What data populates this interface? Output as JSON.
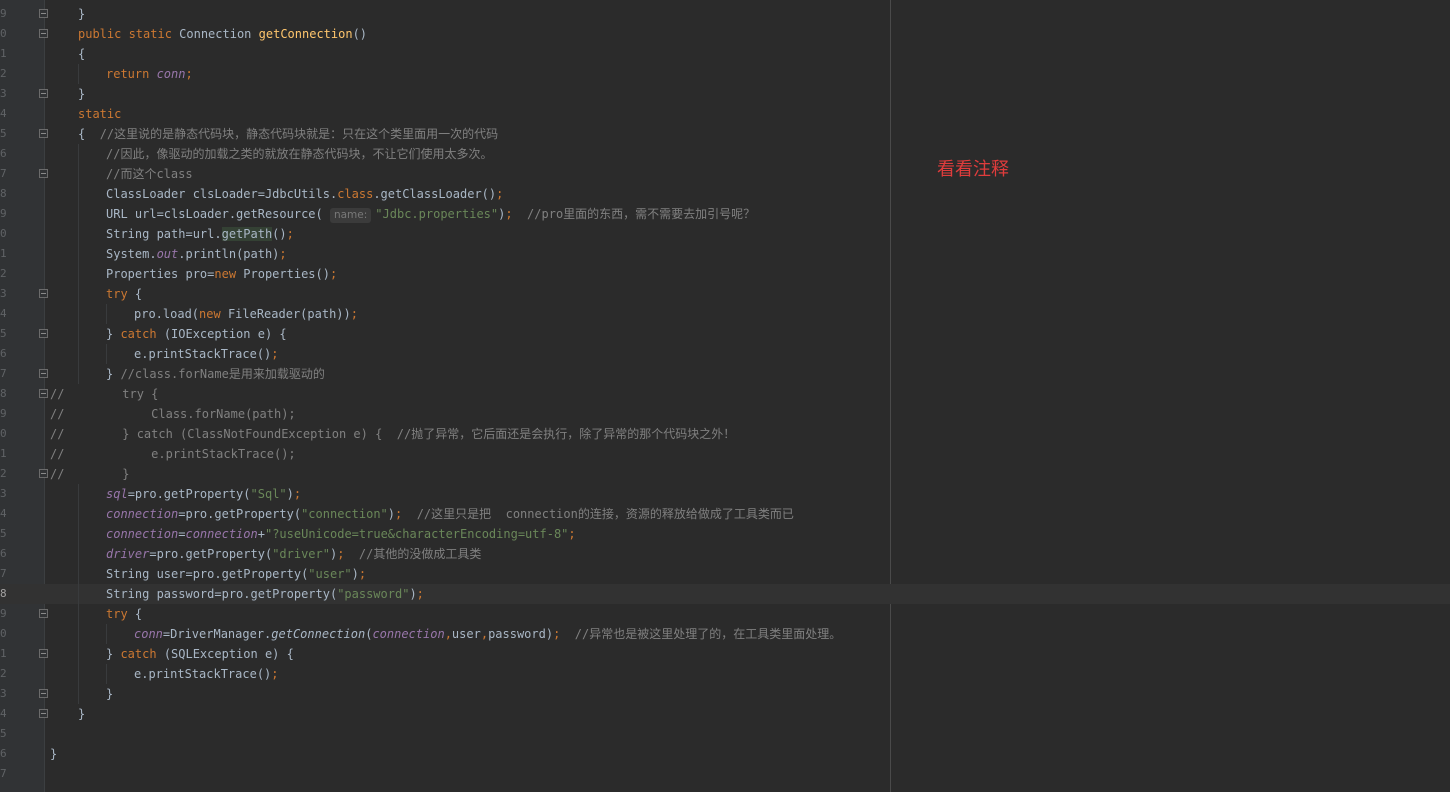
{
  "editor": {
    "lines": [
      {
        "n": "9",
        "fold": true,
        "indent": 1,
        "segs": [
          [
            "",
            "}"
          ]
        ]
      },
      {
        "n": "0",
        "fold": true,
        "indent": 1,
        "segs": [
          [
            "kw",
            "public static "
          ],
          [
            "",
            "Connection "
          ],
          [
            "fn",
            "getConnection"
          ],
          [
            "",
            "()"
          ]
        ]
      },
      {
        "n": "1",
        "fold": false,
        "indent": 1,
        "segs": [
          [
            "",
            "{"
          ]
        ]
      },
      {
        "n": "2",
        "fold": false,
        "indent": 2,
        "segs": [
          [
            "kw",
            "return "
          ],
          [
            "field",
            "conn"
          ],
          [
            "kw",
            ";"
          ]
        ]
      },
      {
        "n": "3",
        "fold": true,
        "indent": 1,
        "segs": [
          [
            "",
            "}"
          ]
        ]
      },
      {
        "n": "4",
        "fold": false,
        "indent": 1,
        "segs": [
          [
            "kw",
            "static"
          ]
        ]
      },
      {
        "n": "5",
        "fold": true,
        "indent": 1,
        "segs": [
          [
            "",
            "{  "
          ],
          [
            "cmt",
            "//这里说的是静态代码块，静态代码块就是：只在这个类里面用一次的代码"
          ]
        ]
      },
      {
        "n": "6",
        "fold": false,
        "indent": 2,
        "segs": [
          [
            "cmt",
            "//因此，像驱动的加载之类的就放在静态代码块，不让它们使用太多次。"
          ]
        ]
      },
      {
        "n": "7",
        "fold": true,
        "indent": 2,
        "segs": [
          [
            "cmt",
            "//而这个class"
          ]
        ]
      },
      {
        "n": "8",
        "fold": false,
        "indent": 2,
        "segs": [
          [
            "",
            "ClassLoader clsLoader=JdbcUtils."
          ],
          [
            "kw",
            "class"
          ],
          [
            "",
            ".getClassLoader()"
          ],
          [
            "kw",
            ";"
          ]
        ]
      },
      {
        "n": "9",
        "fold": false,
        "indent": 2,
        "segs": [
          [
            "",
            "URL url=clsLoader.getResource( "
          ],
          [
            "hint",
            "name:"
          ],
          [
            "str",
            "\"Jdbc.properties\""
          ],
          [
            "",
            ")"
          ],
          [
            "kw",
            ";"
          ],
          [
            "",
            "  "
          ],
          [
            "cmt",
            "//pro里面的东西，需不需要去加引号呢？"
          ]
        ]
      },
      {
        "n": "0",
        "fold": false,
        "indent": 2,
        "segs": [
          [
            "",
            "String path=url."
          ],
          [
            "hl",
            "getPath"
          ],
          [
            "",
            "()"
          ],
          [
            "kw",
            ";"
          ]
        ]
      },
      {
        "n": "1",
        "fold": false,
        "indent": 2,
        "segs": [
          [
            "",
            "System."
          ],
          [
            "static",
            "out"
          ],
          [
            "",
            ".println(path)"
          ],
          [
            "kw",
            ";"
          ]
        ]
      },
      {
        "n": "2",
        "fold": false,
        "indent": 2,
        "segs": [
          [
            "",
            "Properties pro="
          ],
          [
            "kw",
            "new "
          ],
          [
            "",
            "Properties()"
          ],
          [
            "kw",
            ";"
          ]
        ]
      },
      {
        "n": "3",
        "fold": true,
        "indent": 2,
        "segs": [
          [
            "kw",
            "try "
          ],
          [
            "",
            "{"
          ]
        ]
      },
      {
        "n": "4",
        "fold": false,
        "indent": 3,
        "segs": [
          [
            "",
            "pro.load("
          ],
          [
            "kw",
            "new "
          ],
          [
            "",
            "FileReader(path))"
          ],
          [
            "kw",
            ";"
          ]
        ]
      },
      {
        "n": "5",
        "fold": true,
        "indent": 2,
        "segs": [
          [
            "",
            "} "
          ],
          [
            "kw",
            "catch "
          ],
          [
            "",
            "(IOException e) {"
          ]
        ]
      },
      {
        "n": "6",
        "fold": false,
        "indent": 3,
        "segs": [
          [
            "",
            "e.printStackTrace()"
          ],
          [
            "kw",
            ";"
          ]
        ]
      },
      {
        "n": "7",
        "fold": true,
        "indent": 2,
        "segs": [
          [
            "",
            "} "
          ],
          [
            "cmt",
            "//class.forName是用来加载驱动的"
          ]
        ]
      },
      {
        "n": "8",
        "fold": true,
        "indent": 0,
        "segs": [
          [
            "cmt",
            "//        try {"
          ]
        ]
      },
      {
        "n": "9",
        "fold": false,
        "indent": 0,
        "segs": [
          [
            "cmt",
            "//            Class.forName(path);"
          ]
        ]
      },
      {
        "n": "0",
        "fold": false,
        "indent": 0,
        "segs": [
          [
            "cmt",
            "//        } catch (ClassNotFoundException e) {  //抛了异常，它后面还是会执行，除了异常的那个代码块之外！"
          ]
        ]
      },
      {
        "n": "1",
        "fold": false,
        "indent": 0,
        "segs": [
          [
            "cmt",
            "//            e.printStackTrace();"
          ]
        ]
      },
      {
        "n": "2",
        "fold": true,
        "indent": 0,
        "segs": [
          [
            "cmt",
            "//        }"
          ]
        ]
      },
      {
        "n": "3",
        "fold": false,
        "indent": 2,
        "segs": [
          [
            "field",
            "sql"
          ],
          [
            "",
            "=pro.getProperty("
          ],
          [
            "str",
            "\"Sql\""
          ],
          [
            "",
            ")"
          ],
          [
            "kw",
            ";"
          ]
        ]
      },
      {
        "n": "4",
        "fold": false,
        "indent": 2,
        "segs": [
          [
            "field",
            "connection"
          ],
          [
            "",
            "=pro.getProperty("
          ],
          [
            "str",
            "\"connection\""
          ],
          [
            "",
            ")"
          ],
          [
            "kw",
            ";"
          ],
          [
            "",
            "  "
          ],
          [
            "cmt",
            "//这里只是把  connection的连接，资源的释放给做成了工具类而已"
          ]
        ]
      },
      {
        "n": "5",
        "fold": false,
        "indent": 2,
        "segs": [
          [
            "field",
            "connection"
          ],
          [
            "",
            "="
          ],
          [
            "field",
            "connection"
          ],
          [
            "",
            "+"
          ],
          [
            "str",
            "\"?useUnicode=true&characterEncoding=utf-8\""
          ],
          [
            "kw",
            ";"
          ]
        ]
      },
      {
        "n": "6",
        "fold": false,
        "indent": 2,
        "segs": [
          [
            "field",
            "driver"
          ],
          [
            "",
            "=pro.getProperty("
          ],
          [
            "str",
            "\"driver\""
          ],
          [
            "",
            ")"
          ],
          [
            "kw",
            ";"
          ],
          [
            "",
            "  "
          ],
          [
            "cmt",
            "//其他的没做成工具类"
          ]
        ]
      },
      {
        "n": "7",
        "fold": false,
        "indent": 2,
        "segs": [
          [
            "",
            "String user=pro.getProperty("
          ],
          [
            "str",
            "\"user\""
          ],
          [
            "",
            ")"
          ],
          [
            "kw",
            ";"
          ]
        ]
      },
      {
        "n": "8",
        "fold": false,
        "indent": 2,
        "current": true,
        "segs": [
          [
            "",
            "String password=pro.getProperty("
          ],
          [
            "str",
            "\"password\""
          ],
          [
            "",
            ")"
          ],
          [
            "kw",
            ";"
          ]
        ]
      },
      {
        "n": "9",
        "fold": true,
        "indent": 2,
        "segs": [
          [
            "kw",
            "try "
          ],
          [
            "",
            "{"
          ]
        ]
      },
      {
        "n": "0",
        "fold": false,
        "indent": 3,
        "segs": [
          [
            "field",
            "conn"
          ],
          [
            "",
            "=DriverManager."
          ],
          [
            "it",
            "getConnection"
          ],
          [
            "",
            "("
          ],
          [
            "field",
            "connection"
          ],
          [
            "kw",
            ","
          ],
          [
            "",
            "user"
          ],
          [
            "kw",
            ","
          ],
          [
            "",
            "password)"
          ],
          [
            "kw",
            ";"
          ],
          [
            "",
            "  "
          ],
          [
            "cmt",
            "//异常也是被这里处理了的，在工具类里面处理。"
          ]
        ]
      },
      {
        "n": "1",
        "fold": true,
        "indent": 2,
        "segs": [
          [
            "",
            "} "
          ],
          [
            "kw",
            "catch "
          ],
          [
            "",
            "(SQLException e) {"
          ]
        ]
      },
      {
        "n": "2",
        "fold": false,
        "indent": 3,
        "segs": [
          [
            "",
            "e.printStackTrace()"
          ],
          [
            "kw",
            ";"
          ]
        ]
      },
      {
        "n": "3",
        "fold": true,
        "indent": 2,
        "segs": [
          [
            "",
            "}"
          ]
        ]
      },
      {
        "n": "4",
        "fold": true,
        "indent": 1,
        "segs": [
          [
            "",
            "}"
          ]
        ]
      },
      {
        "n": "5",
        "fold": false,
        "indent": 0,
        "segs": []
      },
      {
        "n": "6",
        "fold": false,
        "indent": 0,
        "segs": [
          [
            "",
            "}"
          ]
        ]
      },
      {
        "n": "7",
        "fold": false,
        "indent": 0,
        "segs": []
      }
    ]
  },
  "annotation": {
    "text": "看看注释",
    "color": "#e03c3c"
  },
  "colors": {
    "keyword": "#cc7832",
    "method": "#ffc66d",
    "string": "#6a8759",
    "comment": "#808080",
    "field": "#9876aa",
    "text": "#a9b7c6",
    "background": "#2b2b2b"
  }
}
